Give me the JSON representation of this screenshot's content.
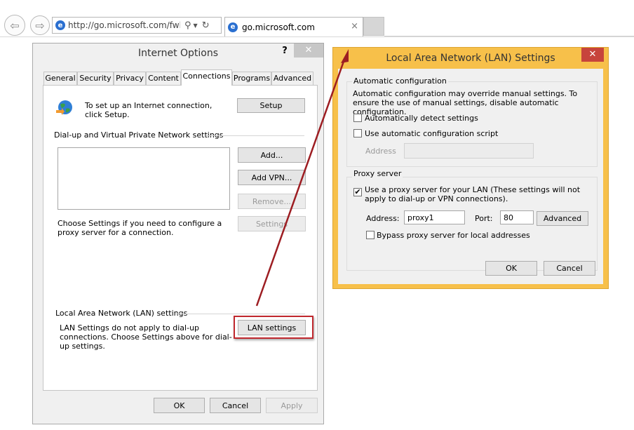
{
  "browser": {
    "address_url": "http://go.microsoft.com/fwlin",
    "tab_title": "go.microsoft.com",
    "tab_close": "×"
  },
  "inet": {
    "title": "Internet Options",
    "help": "?",
    "close": "✕",
    "tabs": [
      "General",
      "Security",
      "Privacy",
      "Content",
      "Connections",
      "Programs",
      "Advanced"
    ],
    "active_tab": "Connections",
    "setup_text": "To set up an Internet connection, click Setup.",
    "setup_button": "Setup",
    "dialup_header": "Dial-up and Virtual Private Network settings",
    "add_button": "Add...",
    "add_vpn_button": "Add VPN...",
    "remove_button": "Remove...",
    "settings_button": "Settings",
    "settings_text": "Choose Settings if you need to configure a proxy server for a connection.",
    "lan_header": "Local Area Network (LAN) settings",
    "lan_text": "LAN Settings do not apply to dial-up connections. Choose Settings above for dial-up settings.",
    "lan_button": "LAN settings",
    "ok": "OK",
    "cancel": "Cancel",
    "apply": "Apply"
  },
  "lan": {
    "title": "Local Area Network (LAN) Settings",
    "close": "✕",
    "auto_header": "Automatic configuration",
    "auto_text": "Automatic configuration may override manual settings.  To ensure the use of manual settings, disable automatic configuration.",
    "auto_detect_label": "Automatically detect settings",
    "auto_detect_checked": false,
    "auto_script_label": "Use automatic configuration script",
    "auto_script_checked": false,
    "script_address_label": "Address",
    "script_address_value": "",
    "proxy_header": "Proxy server",
    "use_proxy_label": "Use a proxy server for your LAN (These settings will not apply to dial-up or VPN connections).",
    "use_proxy_checked": true,
    "check_mark": "✔",
    "address_label": "Address:",
    "address_value": "proxy1",
    "port_label": "Port:",
    "port_value": "80",
    "advanced_button": "Advanced",
    "bypass_label": "Bypass proxy server for local addresses",
    "bypass_checked": false,
    "ok": "OK",
    "cancel": "Cancel"
  },
  "colors": {
    "lan_frame": "#f7c04a",
    "highlight": "#c0282e",
    "arrow": "#9d1d22"
  },
  "icons": [
    "back-icon",
    "forward-icon",
    "ie-icon",
    "search-icon",
    "dropdown-icon",
    "refresh-icon",
    "close-icon",
    "help-icon",
    "globe-setup-icon",
    "check-icon"
  ]
}
